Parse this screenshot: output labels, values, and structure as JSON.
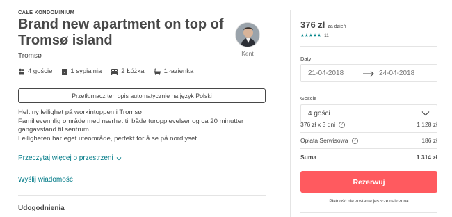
{
  "listing": {
    "kind": "CAŁE KONDOMINIUM",
    "title": "Brand new apartment on top of Tromsø island",
    "city": "Tromsø",
    "host_name": "Kent",
    "amenities": {
      "guests": "4 goście",
      "bedrooms": "1 sypialnia",
      "beds": "2 Łóżka",
      "bathrooms": "1 łazienka"
    },
    "translate_button": "Przetłumacz ten opis automatycznie na język Polski",
    "description": [
      "Helt ny leilighet på workintoppen i Tromsø.",
      "Familievennlig område med nærhet til både turopplevelser og ca 20 minutter gangavstand til sentrum.",
      "Leiligheten har eget uteområde, perfekt for å se på nordlyset."
    ],
    "read_more": "Przeczytaj więcej o przestrzeni",
    "contact_host": "Wyślij wiadomość",
    "amenities_heading": "Udogodnienia"
  },
  "booking": {
    "price": "376 zł",
    "per_night": "za dzień",
    "stars": "★★★★★",
    "review_count": "11",
    "rating_value": 5,
    "dates_label": "Daty",
    "checkin": "21-04-2018",
    "checkout": "24-04-2018",
    "guests_label": "Goście",
    "guests_value": "4 gości",
    "nights_line": "376 zł x 3 dni",
    "nights_total": "1 128 zł",
    "service_fee_label": "Opłata Serwisowa",
    "service_fee": "186 zł",
    "sum_label": "Suma",
    "sum_total": "1 314 zł",
    "book_button": "Rezerwuj",
    "note": "Płatność nie zostanie jeszcze naliczona"
  },
  "icons": [
    "guests-icon",
    "bedroom-icon",
    "bed-icon",
    "bathroom-icon",
    "chevron-down-icon",
    "arrow-right-icon",
    "help-icon",
    "star-icon"
  ],
  "colors": {
    "accent": "#ff5a5f",
    "link": "#007a87",
    "stars": "#008489",
    "text": "#484848"
  }
}
